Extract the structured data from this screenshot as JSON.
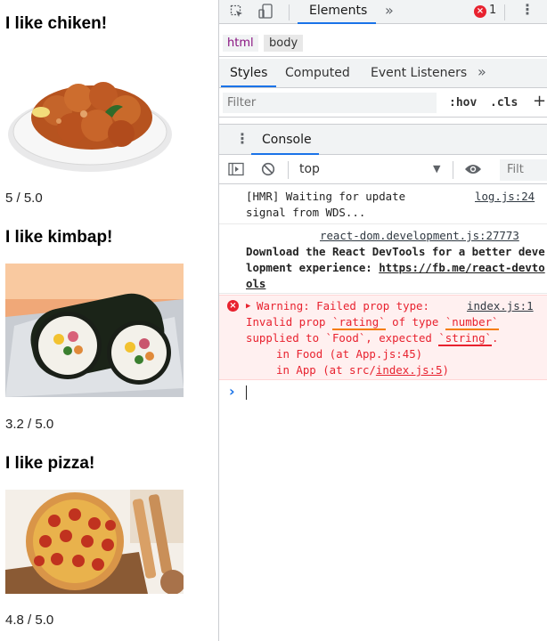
{
  "foods": [
    {
      "heading": "I like chiken!",
      "rating": "5 / 5.0",
      "image": "fried chicken on a white plate"
    },
    {
      "heading": "I like kimbap!",
      "rating": "3.2 / 5.0",
      "image": "kimbap rolls on foil"
    },
    {
      "heading": "I like pizza!",
      "rating": "4.8 / 5.0",
      "image": "pepperoni pizza on a board"
    }
  ],
  "devtools": {
    "main_tab": "Elements",
    "more": "»",
    "error_count": "1",
    "breadcrumb": [
      "html",
      "body"
    ],
    "styles_tabs": [
      "Styles",
      "Computed",
      "Event Listeners"
    ],
    "filter_placeholder": "Filter",
    "hov": ":hov",
    "cls": ".cls",
    "plus": "+",
    "drawer_tab": "Console",
    "context": "top",
    "console_filter": "Filt",
    "messages": {
      "hmr": "[HMR] Waiting for update signal from WDS...",
      "hmr_src": "log.js:24",
      "react_src": "react-dom.development.js:27773",
      "react_text": "Download the React DevTools for a better development experience: ",
      "react_link": "https://fb.me/react-devtools",
      "warn_src": "index.js:1",
      "warn_line1": "Warning: Failed prop type:",
      "warn_invalid": "Invalid prop ",
      "warn_prop": "`rating`",
      "warn_oftype": " of type ",
      "warn_type": "`number`",
      "warn_supplied": "supplied to `Food`, expected ",
      "warn_expected": "`string`",
      "warn_period": ".",
      "warn_in_food": "in Food (at App.js:45)",
      "warn_in_app_pre": "in App (at src/",
      "warn_in_app_link": "index.js:5",
      "warn_in_app_post": ")"
    },
    "prompt": "›"
  },
  "colors": {
    "accent": "#1a73e8",
    "error_bg": "#fff0f0",
    "error_text": "#e8222f",
    "error_border": "#ffd6d6",
    "highlight_orange": "#f57c00",
    "highlight_red": "#e8222f"
  }
}
